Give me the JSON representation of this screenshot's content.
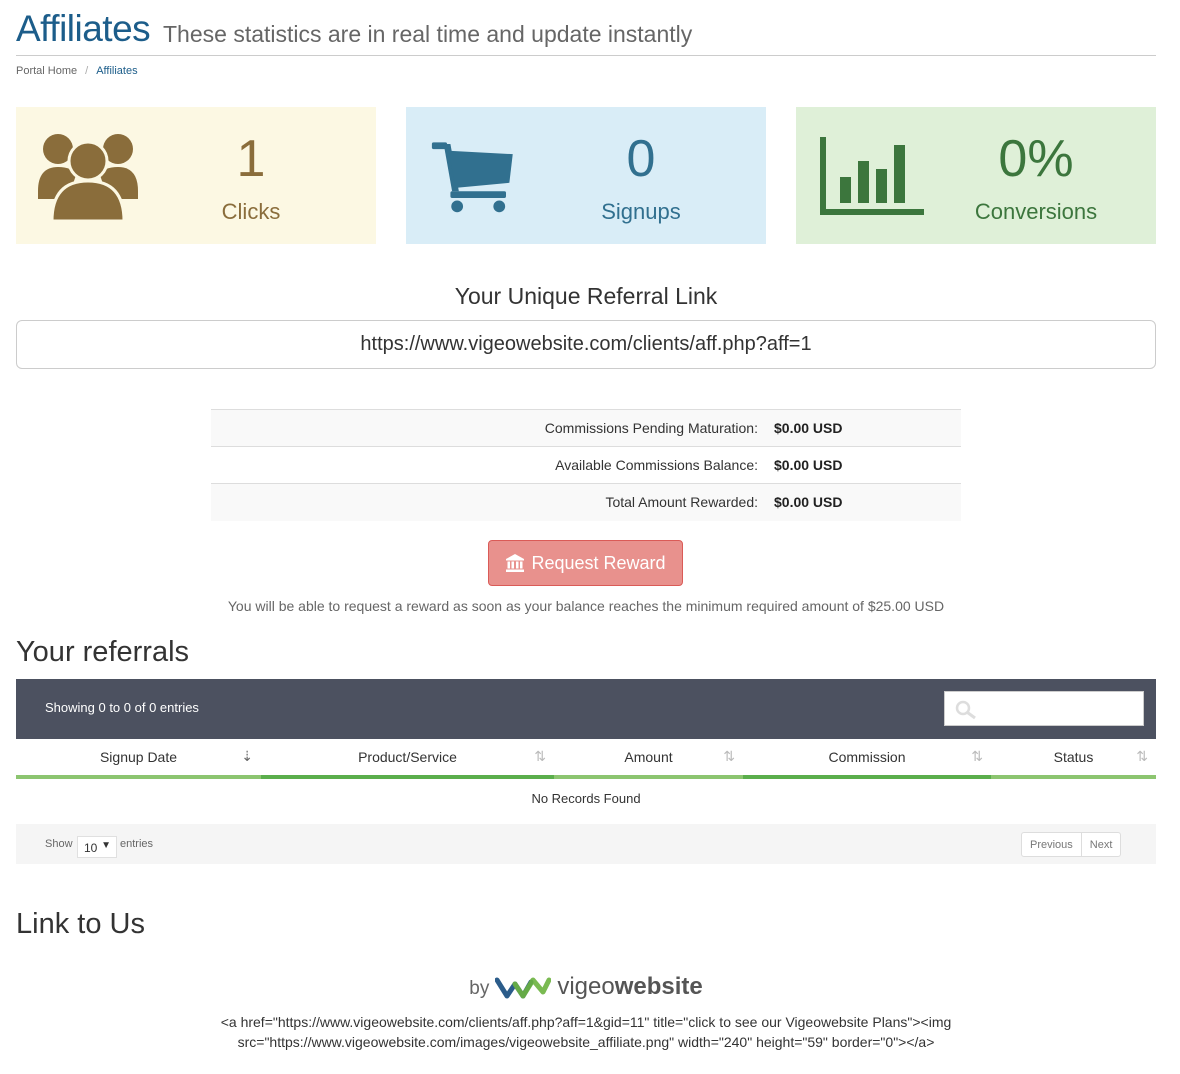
{
  "header": {
    "title": "Affiliates",
    "subtitle": "These statistics are in real time and update instantly"
  },
  "breadcrumb": {
    "home": "Portal Home",
    "sep": "/",
    "current": "Affiliates"
  },
  "stats": {
    "clicks": {
      "value": "1",
      "label": "Clicks",
      "icon": "users-icon"
    },
    "signups": {
      "value": "0",
      "label": "Signups",
      "icon": "shopping-cart-icon"
    },
    "conversions": {
      "value": "0%",
      "label": "Conversions",
      "icon": "bar-chart-icon"
    }
  },
  "referral": {
    "heading": "Your Unique Referral Link",
    "link": "https://www.vigeowebsite.com/clients/aff.php?aff=1"
  },
  "commissions": [
    {
      "label": "Commissions Pending Maturation:",
      "value": "$0.00 USD"
    },
    {
      "label": "Available Commissions Balance:",
      "value": "$0.00 USD"
    },
    {
      "label": "Total Amount Rewarded:",
      "value": "$0.00 USD"
    }
  ],
  "reward": {
    "button_label": "Request Reward",
    "icon": "bank-icon",
    "note": "You will be able to request a reward as soon as your balance reaches the minimum required amount of $25.00 USD"
  },
  "referrals": {
    "title": "Your referrals",
    "info": "Showing 0 to 0 of 0 entries",
    "search_placeholder": "",
    "columns": [
      "Signup Date",
      "Product/Service",
      "Amount",
      "Commission",
      "Status"
    ],
    "empty": "No Records Found",
    "show_label": "Show",
    "page_size": "10",
    "entries_label": "entries",
    "prev": "Previous",
    "next": "Next"
  },
  "link_to_us": {
    "title": "Link to Us",
    "banner_by": "by",
    "brand_part1": "vigeo",
    "brand_part2": "website",
    "code_line1": "<a href=\"https://www.vigeowebsite.com/clients/aff.php?aff=1&gid=11\" title=\"click to see our Vigeowebsite Plans\"><img",
    "code_line2": "src=\"https://www.vigeowebsite.com/images/vigeowebsite_affiliate.png\" width=\"240\" height=\"59\" border=\"0\"></a>"
  },
  "colors": {
    "title_blue": "#1c5d8a",
    "clicks_bg": "#fcf8e3",
    "clicks_fg": "#8a6d3b",
    "signups_bg": "#d9edf7",
    "signups_fg": "#31708f",
    "conv_bg": "#dff0d8",
    "conv_fg": "#3c763d",
    "reward_btn": "#e78c87",
    "table_header": "#4c5160",
    "column_underline": "#8cc570"
  }
}
